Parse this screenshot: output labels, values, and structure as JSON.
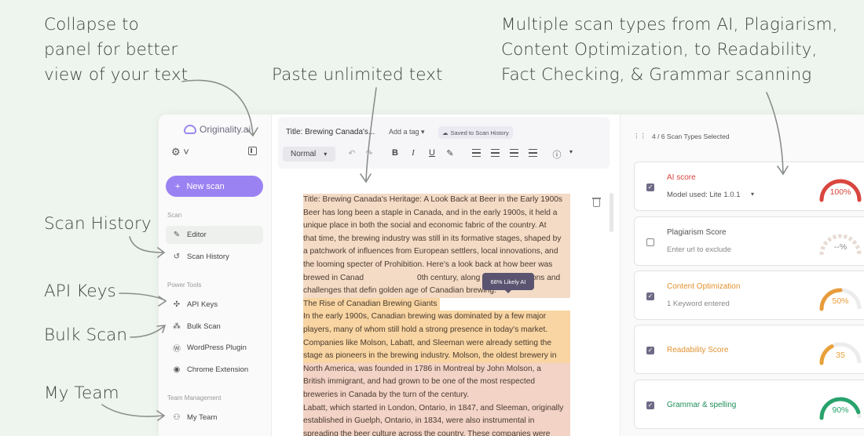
{
  "annotations": {
    "collapse": [
      "Collapse to",
      "panel for better",
      "view of your text"
    ],
    "paste": "Paste unlimited text",
    "scan_types": [
      "Multiple scan types from AI, Plagiarism,",
      "Content Optimization, to Readability,",
      "Fact Checking, & Grammar scanning"
    ],
    "scan_history": "Scan History",
    "api_keys": "API Keys",
    "bulk_scan": "Bulk Scan",
    "my_team": "My Team"
  },
  "sidebar": {
    "logo": "Originality.ai",
    "new_scan": "New scan",
    "section_scan": "Scan",
    "section_power": "Power Tools",
    "section_team": "Team Management",
    "items": {
      "editor": "Editor",
      "scan_history": "Scan History",
      "api_keys": "API Keys",
      "bulk_scan": "Bulk Scan",
      "wordpress": "WordPress Plugin",
      "chrome": "Chrome Extension",
      "my_team": "My Team"
    }
  },
  "toolbar": {
    "title": "Title: Brewing Canada's...",
    "add_tag": "Add a tag",
    "saved": "Saved to Scan History",
    "style": "Normal"
  },
  "document": {
    "lines": [
      "Title: Brewing Canada's Heritage: A Look Back at Beer in the Early 1900s",
      "Beer has long been a staple in Canada, and in the early 1900s, it held a",
      "unique place in both the social and economic fabric of the country. At",
      "that time, the brewing industry was still in its formative stages, shaped by",
      "a patchwork of influences from European settlers, local innovations, and",
      "the looming specter of Prohibition. Here's a look back at how beer was",
      "brewed in Canad",
      "challenges that defin",
      "The Rise of Canadian Brewing Giants",
      "In the early 1900s, Canadian brewing was dominated by a few major",
      "players, many of whom still hold a strong presence in today's market.",
      "Companies like Molson, Labatt, and Sleeman were already setting the",
      "stage as pioneers in the brewing industry. Molson, the oldest brewery in",
      "North America, was founded in 1786 in Montreal by John Molson, a",
      "British immigrant, and had grown to be one of the most respected",
      "breweries in Canada by the turn of the century.",
      "Labatt, which started in London, Ontario, in 1847, and Sleeman, originally",
      "established in Guelph, Ontario, in 1834, were also instrumental in",
      "spreading the beer culture across the country. These companies were"
    ],
    "line7_tail": "0th century, along with the traditions and",
    "line8_tail": "golden age of Canadian brewing.",
    "tooltip": "68% Likely AI"
  },
  "panel": {
    "header": "4 / 6 Scan Types Selected",
    "cards": [
      {
        "title": "AI score",
        "sub": "Model used: Lite 1.0.1",
        "value": "100%",
        "color": "#d9453f",
        "pct": 100,
        "checked": true
      },
      {
        "title": "Plagiarism Score",
        "sub": "Enter url to exclude",
        "value": "--%",
        "color": "#9fc7ad",
        "pct": 0,
        "checked": false
      },
      {
        "title": "Content Optimization",
        "sub": "1 Keyword entered",
        "value": "50%",
        "color": "#e89b3a",
        "pct": 50,
        "checked": true
      },
      {
        "title": "Readability Score",
        "sub": "",
        "value": "35",
        "color": "#e8a13a",
        "pct": 35,
        "checked": true
      },
      {
        "title": "Grammar & spelling",
        "sub": "",
        "value": "90%",
        "color": "#27a36b",
        "pct": 90,
        "checked": true
      }
    ]
  }
}
